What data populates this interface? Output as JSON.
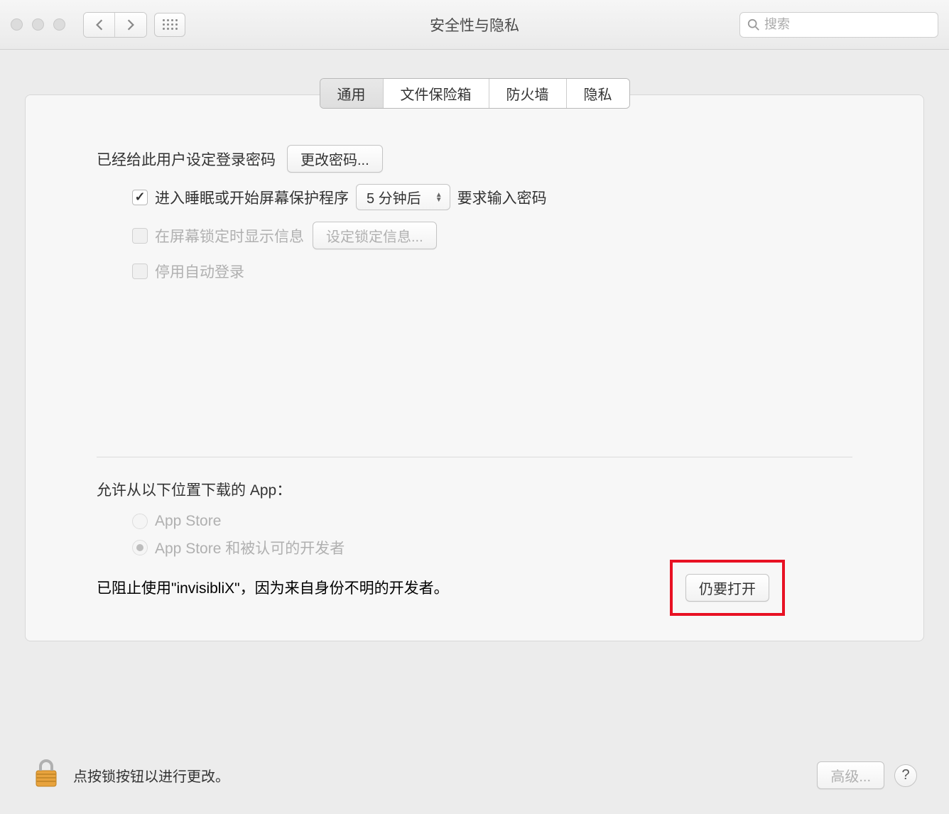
{
  "window": {
    "title": "安全性与隐私"
  },
  "search": {
    "placeholder": "搜索"
  },
  "tabs": {
    "general": "通用",
    "filevault": "文件保险箱",
    "firewall": "防火墙",
    "privacy": "隐私"
  },
  "general": {
    "password_set_label": "已经给此用户设定登录密码",
    "change_password_btn": "更改密码...",
    "require_password_label": "进入睡眠或开始屏幕保护程序",
    "require_password_delay": "5 分钟后",
    "require_password_suffix": "要求输入密码",
    "show_lock_message_label": "在屏幕锁定时显示信息",
    "set_lock_message_btn": "设定锁定信息...",
    "disable_auto_login_label": "停用自动登录"
  },
  "allow_apps": {
    "header": "允许从以下位置下载的 App：",
    "option_appstore": "App Store",
    "option_identified": "App Store 和被认可的开发者",
    "blocked_message": "已阻止使用\"invisibliX\"，因为来自身份不明的开发者。",
    "open_anyway_btn": "仍要打开"
  },
  "footer": {
    "lock_text": "点按锁按钮以进行更改。",
    "advanced_btn": "高级...",
    "help": "?"
  }
}
